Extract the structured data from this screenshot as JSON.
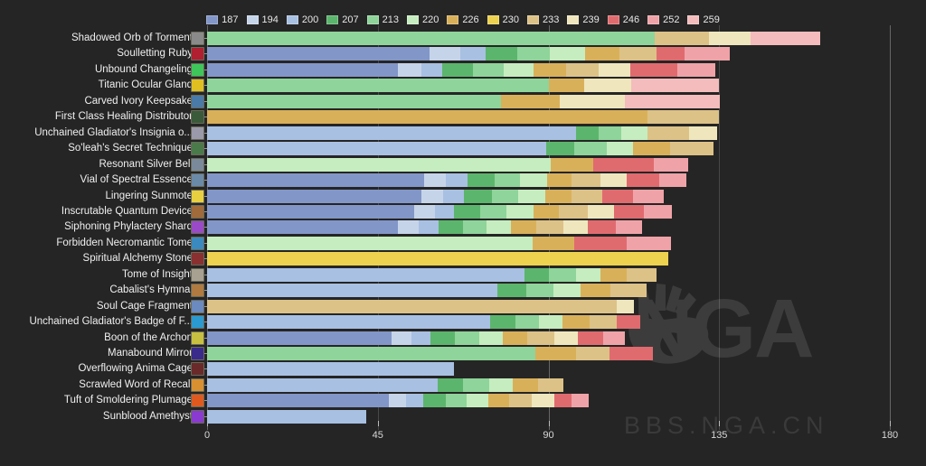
{
  "chart_data": {
    "type": "bar",
    "orientation": "horizontal",
    "stacked": true,
    "title": "",
    "xlabel": "",
    "ylabel": "",
    "xlim": [
      0,
      180
    ],
    "xticks": [
      0,
      45,
      90,
      135,
      180
    ],
    "xtick_labels": [
      "0",
      "45",
      "90",
      "135",
      "180"
    ],
    "grid": true,
    "legend_position": "top-center",
    "legend_title": "",
    "series": [
      {
        "name": "187",
        "color": "#8296c8"
      },
      {
        "name": "194",
        "color": "#c6d4ea"
      },
      {
        "name": "200",
        "color": "#a8c0e2"
      },
      {
        "name": "207",
        "color": "#5cb56c"
      },
      {
        "name": "213",
        "color": "#8fd49a"
      },
      {
        "name": "220",
        "color": "#c6edbf"
      },
      {
        "name": "226",
        "color": "#d9b05a"
      },
      {
        "name": "230",
        "color": "#ecd24f"
      },
      {
        "name": "233",
        "color": "#ddc287"
      },
      {
        "name": "239",
        "color": "#efe6bd"
      },
      {
        "name": "246",
        "color": "#e06b6f"
      },
      {
        "name": "252",
        "color": "#efa3a8"
      },
      {
        "name": "259",
        "color": "#f4bcbc"
      }
    ],
    "categories": [
      "Shadowed Orb of Torment",
      "Soulletting Ruby",
      "Unbound Changeling",
      "Titanic Ocular Gland",
      "Carved Ivory Keepsake",
      "First Class Healing Distributor",
      "Unchained Gladiator's Insignia o...",
      "So'leah's Secret Technique",
      "Resonant Silver Bell",
      "Vial of Spectral Essence",
      "Lingering Sunmote",
      "Inscrutable Quantum Device",
      "Siphoning Phylactery Shard",
      "Forbidden Necromantic Tome",
      "Spiritual Alchemy Stone",
      "Tome of Insight",
      "Cabalist's Hymnal",
      "Soul Cage Fragment",
      "Unchained Gladiator's Badge of F...",
      "Boon of the Archon",
      "Manabound Mirror",
      "Overflowing Anima Cage",
      "Scrawled Word of Recall",
      "Tuft of Smoldering Plumage",
      "Sunblood Amethyst"
    ],
    "icon_colors": [
      "#8a8a8a",
      "#b02030",
      "#3ec65a",
      "#e0c020",
      "#4a7aa8",
      "#3a5a3a",
      "#9a9aaa",
      "#4a7a4a",
      "#7a8a9a",
      "#6a8aa8",
      "#e8d040",
      "#a06a3a",
      "#9a4ac8",
      "#3a8ac0",
      "#8a3030",
      "#a8a090",
      "#b07a40",
      "#6a8ac0",
      "#2a9ad0",
      "#c8c040",
      "#3a2a8a",
      "#6a2a2a",
      "#d89030",
      "#e05a20",
      "#8a3ad0"
    ],
    "rows": [
      {
        "category": "Shadowed Orb of Torment",
        "values": [
          0,
          0,
          0,
          0,
          118,
          0,
          0,
          0,
          14.3,
          11,
          0,
          0,
          18.4
        ]
      },
      {
        "category": "Soulletting Ruby",
        "values": [
          58.6,
          8.1,
          6.7,
          8.4,
          8.6,
          9.3,
          9.1,
          0,
          9.6,
          0,
          7.4,
          12.1,
          0
        ]
      },
      {
        "category": "Unbound Changeling",
        "values": [
          50.4,
          6.0,
          5.5,
          8.2,
          8.1,
          7.9,
          8.6,
          0,
          8.6,
          8.2,
          12.4,
          10.2,
          0
        ]
      },
      {
        "category": "Titanic Ocular Gland",
        "values": [
          0,
          0,
          0,
          0,
          90,
          0,
          9.5,
          0,
          0,
          12.4,
          0,
          0,
          23.1
        ]
      },
      {
        "category": "Carved Ivory Keepsake",
        "values": [
          0,
          0,
          0,
          0,
          77.5,
          0,
          15.5,
          0,
          0,
          17.1,
          0,
          0,
          25.1
        ]
      },
      {
        "category": "First Class Healing Distributor",
        "values": [
          0,
          0,
          0,
          0,
          0,
          0,
          116,
          0,
          19,
          0,
          0,
          0,
          0
        ]
      },
      {
        "category": "Unchained Gladiator's Insignia o...",
        "values": [
          0,
          0,
          97.2,
          6.0,
          6.0,
          6.8,
          0,
          0,
          11.2,
          7.2,
          0,
          0,
          0
        ]
      },
      {
        "category": "So'leah's Secret Technique",
        "values": [
          0,
          0,
          89.4,
          7.3,
          8.6,
          7.0,
          9.7,
          0,
          11.6,
          0,
          0,
          0,
          0
        ]
      },
      {
        "category": "Resonant Silver Bell",
        "values": [
          0,
          0,
          0,
          0,
          0,
          90.5,
          11.4,
          0,
          0,
          0,
          15.9,
          9.1,
          0
        ]
      },
      {
        "category": "Vial of Spectral Essence",
        "values": [
          57.3,
          5.7,
          5.6,
          7.2,
          6.7,
          7.2,
          6.5,
          0,
          7.6,
          6.9,
          8.5,
          7.2,
          0
        ]
      },
      {
        "category": "Lingering Sunmote",
        "values": [
          56.6,
          5.6,
          5.4,
          7.4,
          7.1,
          7.0,
          6.9,
          0,
          8.3,
          0,
          8.0,
          8.1,
          0
        ]
      },
      {
        "category": "Inscrutable Quantum Device",
        "values": [
          54.5,
          5.5,
          5.1,
          6.9,
          6.8,
          7.2,
          6.8,
          0,
          7.6,
          6.8,
          7.9,
          7.4,
          0
        ]
      },
      {
        "category": "Siphoning Phylactery Shard",
        "values": [
          50.2,
          5.7,
          5.1,
          6.4,
          6.2,
          6.6,
          6.5,
          0,
          7.2,
          6.4,
          7.4,
          7.0,
          0
        ]
      },
      {
        "category": "Forbidden Necromantic Tome",
        "values": [
          0,
          0,
          0,
          0,
          0,
          85.8,
          10.9,
          0,
          0,
          0,
          13.9,
          11.7,
          0
        ]
      },
      {
        "category": "Spiritual Alchemy Stone",
        "values": [
          0,
          0,
          0,
          0,
          0,
          0,
          0,
          121.5,
          0,
          0,
          0,
          0,
          0
        ]
      },
      {
        "category": "Tome of Insight",
        "values": [
          0,
          0,
          83.6,
          6.6,
          7.0,
          6.4,
          7.0,
          0,
          7.9,
          0,
          0,
          0,
          0
        ]
      },
      {
        "category": "Cabalist's Hymnal",
        "values": [
          0,
          0,
          76.6,
          7.5,
          7.2,
          7.2,
          7.8,
          0,
          9.6,
          0,
          0,
          0,
          0
        ]
      },
      {
        "category": "Soul Cage Fragment",
        "values": [
          0,
          0,
          0,
          0,
          0,
          0,
          0,
          0,
          108,
          4.5,
          0,
          0,
          0
        ]
      },
      {
        "category": "Unchained Gladiator's Badge of F...",
        "values": [
          0,
          0,
          74.6,
          6.7,
          6.1,
          6.3,
          7.1,
          0,
          7.3,
          0,
          6.2,
          0,
          0
        ]
      },
      {
        "category": "Boon of the Archon",
        "values": [
          48.6,
          5.3,
          5.1,
          6.4,
          6.3,
          6.2,
          6.6,
          0,
          7.0,
          6.2,
          6.7,
          5.8,
          0
        ]
      },
      {
        "category": "Manabound Mirror",
        "values": [
          0,
          0,
          0,
          0,
          86.5,
          0,
          10.8,
          0,
          8.8,
          0,
          11.4,
          0,
          0
        ]
      },
      {
        "category": "Overflowing Anima Cage",
        "values": [
          0,
          0,
          65.0,
          0,
          0,
          0,
          0,
          0,
          0,
          0,
          0,
          0,
          0
        ]
      },
      {
        "category": "Scrawled Word of Recall",
        "values": [
          0,
          0,
          60.7,
          6.8,
          6.8,
          6.4,
          6.6,
          0,
          6.6,
          0,
          0,
          0,
          0
        ]
      },
      {
        "category": "Tuft of Smoldering Plumage",
        "values": [
          48.0,
          4.4,
          4.7,
          5.8,
          5.6,
          5.7,
          5.4,
          0,
          6.1,
          5.8,
          4.7,
          4.5,
          0
        ]
      },
      {
        "category": "Sunblood Amethyst",
        "values": [
          0,
          0,
          42.0,
          0,
          0,
          0,
          0,
          0,
          0,
          0,
          0,
          0,
          0
        ]
      }
    ]
  },
  "watermark": {
    "brand": "NGA",
    "site": "BBS.NGA.CN",
    "logo": "paw-icon"
  }
}
